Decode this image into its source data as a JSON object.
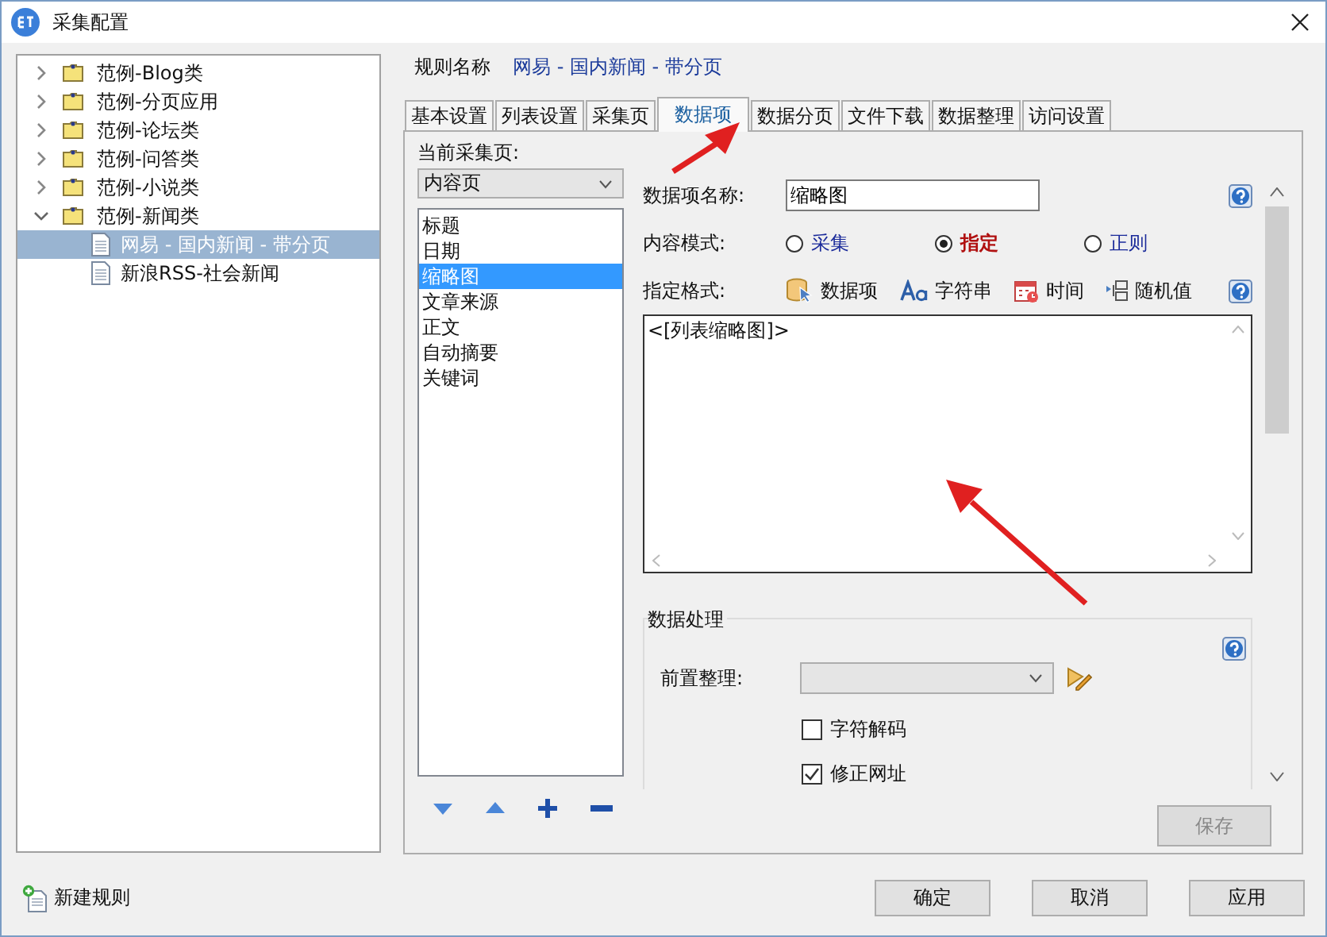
{
  "window": {
    "title": "采集配置"
  },
  "tree": [
    {
      "label": "范例-Blog类",
      "expanded": false,
      "selected": false
    },
    {
      "label": "范例-分页应用",
      "expanded": false,
      "selected": false
    },
    {
      "label": "范例-论坛类",
      "expanded": false,
      "selected": false
    },
    {
      "label": "范例-问答类",
      "expanded": false,
      "selected": false
    },
    {
      "label": "范例-小说类",
      "expanded": false,
      "selected": false
    },
    {
      "label": "范例-新闻类",
      "expanded": true,
      "selected": false,
      "children": [
        {
          "label": "网易 - 国内新闻 - 带分页",
          "selected": true
        },
        {
          "label": "新浪RSS-社会新闻",
          "selected": false
        }
      ]
    }
  ],
  "rule": {
    "label": "规则名称",
    "name": "网易 - 国内新闻 - 带分页"
  },
  "tabs": [
    {
      "label": "基本设置",
      "selected": false
    },
    {
      "label": "列表设置",
      "selected": false
    },
    {
      "label": "采集页",
      "selected": false
    },
    {
      "label": "数据项",
      "selected": true
    },
    {
      "label": "数据分页",
      "selected": false
    },
    {
      "label": "文件下载",
      "selected": false
    },
    {
      "label": "数据整理",
      "selected": false
    },
    {
      "label": "访问设置",
      "selected": false
    }
  ],
  "page_select": {
    "label": "当前采集页:",
    "value": "内容页"
  },
  "data_items": [
    {
      "label": "标题",
      "selected": false
    },
    {
      "label": "日期",
      "selected": false
    },
    {
      "label": "缩略图",
      "selected": true
    },
    {
      "label": "文章来源",
      "selected": false
    },
    {
      "label": "正文",
      "selected": false
    },
    {
      "label": "自动摘要",
      "selected": false
    },
    {
      "label": "关键词",
      "selected": false
    }
  ],
  "form": {
    "name_label": "数据项名称:",
    "name_value": "缩略图",
    "mode_label": "内容模式:",
    "modes": [
      {
        "label": "采集",
        "selected": false
      },
      {
        "label": "指定",
        "selected": true
      },
      {
        "label": "正则",
        "selected": false
      }
    ],
    "format_label": "指定格式:",
    "format_tools": [
      {
        "kind": "data",
        "label": "数据项"
      },
      {
        "kind": "string",
        "label": "字符串"
      },
      {
        "kind": "time",
        "label": "时间"
      },
      {
        "kind": "random",
        "label": "随机值"
      }
    ],
    "format_value": "<[列表缩略图]>"
  },
  "processing": {
    "title": "数据处理",
    "pre_label": "前置整理:",
    "options": [
      {
        "label": "字符解码",
        "checked": false
      },
      {
        "label": "修正网址",
        "checked": true
      }
    ]
  },
  "save_button": {
    "label": "保存",
    "disabled": true
  },
  "new_rule": "新建规则",
  "buttons": [
    "确定",
    "取消",
    "应用"
  ]
}
